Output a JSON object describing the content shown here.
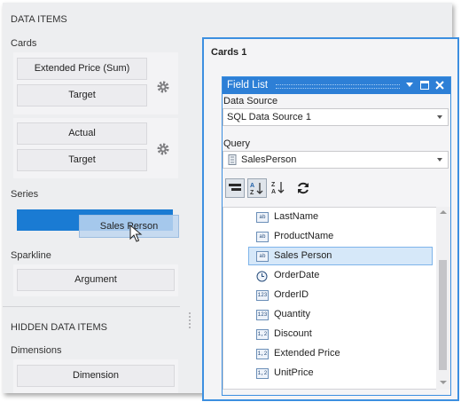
{
  "left_panel": {
    "data_items_header": "DATA ITEMS",
    "cards_label": "Cards",
    "cards_groups": [
      {
        "slots": [
          "Extended Price (Sum)",
          "Target"
        ]
      },
      {
        "slots": [
          "Actual",
          "Target"
        ]
      }
    ],
    "series_label": "Series",
    "drag_ghost_label": "Sales Person",
    "sparkline_label": "Sparkline",
    "sparkline_slot": "Argument",
    "hidden_header": "HIDDEN DATA ITEMS",
    "dimensions_label": "Dimensions",
    "dimension_slot": "Dimension"
  },
  "cards_pane": {
    "title": "Cards 1"
  },
  "field_list": {
    "title": "Field List",
    "data_source_label": "Data Source",
    "data_source_value": "SQL Data Source 1",
    "query_label": "Query",
    "query_value": "SalesPerson",
    "fields": [
      {
        "name": "LastName",
        "type": "ab",
        "selected": false
      },
      {
        "name": "ProductName",
        "type": "ab",
        "selected": false
      },
      {
        "name": "Sales Person",
        "type": "ab",
        "selected": true
      },
      {
        "name": "OrderDate",
        "type": "date",
        "selected": false
      },
      {
        "name": "OrderID",
        "type": "123",
        "selected": false
      },
      {
        "name": "Quantity",
        "type": "123",
        "selected": false
      },
      {
        "name": "Discount",
        "type": "1,2",
        "selected": false
      },
      {
        "name": "Extended Price",
        "type": "1,2",
        "selected": false
      },
      {
        "name": "UnitPrice",
        "type": "1,2",
        "selected": false
      }
    ]
  },
  "colors": {
    "accent": "#2d7fd6",
    "series_bar": "#1a7bd3",
    "selection": "#d6e8f9"
  }
}
